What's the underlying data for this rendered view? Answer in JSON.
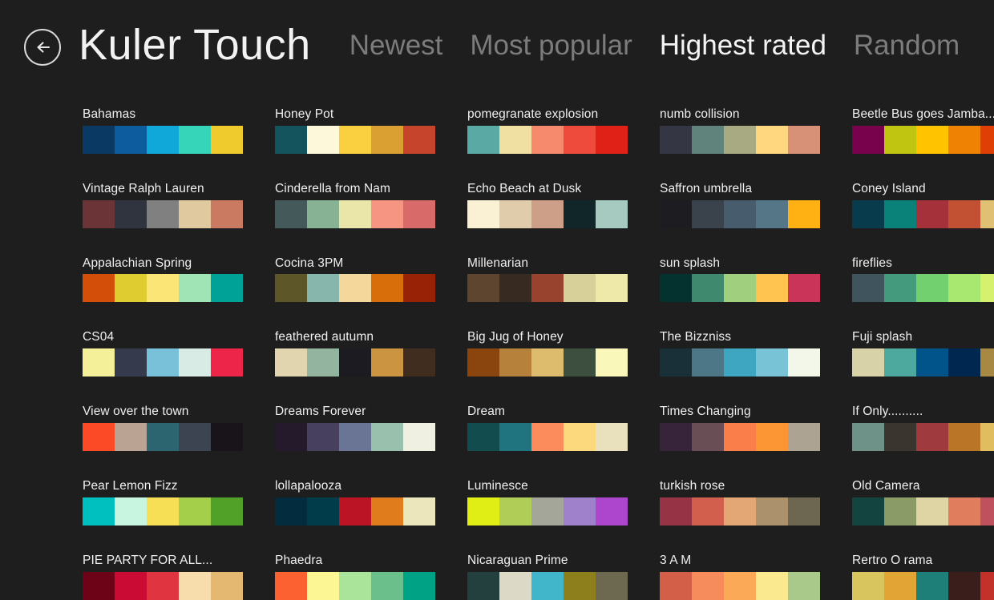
{
  "window": {
    "background": "#1e1e1e",
    "title": "Kuler Touch"
  },
  "header": {
    "back_icon": "back-arrow-circle-icon",
    "title": "Kuler Touch",
    "tabs": [
      {
        "label": "Newest",
        "active": false
      },
      {
        "label": "Most popular",
        "active": false
      },
      {
        "label": "Highest rated",
        "active": true
      },
      {
        "label": "Random",
        "active": false
      }
    ]
  },
  "columns": [
    {
      "palettes": [
        {
          "name": "Bahamas",
          "colors": [
            "#0a3a63",
            "#0c5c9e",
            "#0fa8d8",
            "#36d5ba",
            "#efcb2e"
          ]
        },
        {
          "name": "Vintage Ralph Lauren",
          "colors": [
            "#6b3436",
            "#30343f",
            "#808080",
            "#e0c89f",
            "#cb7a62"
          ]
        },
        {
          "name": "Appalachian Spring",
          "colors": [
            "#d34f09",
            "#dfcc31",
            "#fbe576",
            "#a0e3b5",
            "#00a298"
          ]
        },
        {
          "name": "CS04",
          "colors": [
            "#f4f09a",
            "#353a4c",
            "#79c1d9",
            "#d8ebe4",
            "#ec2549"
          ]
        },
        {
          "name": "View over the town",
          "colors": [
            "#fb4a25",
            "#bba393",
            "#2c6570",
            "#3b4450",
            "#191419"
          ]
        },
        {
          "name": "Pear Lemon Fizz",
          "colors": [
            "#00bfbf",
            "#c8f5e0",
            "#f6df55",
            "#a4cf4b",
            "#51a027"
          ]
        },
        {
          "name": "PIE PARTY  FOR ALL...",
          "colors": [
            "#6c0317",
            "#ca0b33",
            "#e03540",
            "#f6ddab",
            "#e5b872"
          ]
        }
      ]
    },
    {
      "palettes": [
        {
          "name": "Honey Pot",
          "colors": [
            "#14545c",
            "#fdf8d9",
            "#fad041",
            "#dba032",
            "#c7442c"
          ]
        },
        {
          "name": "Cinderella from Nam",
          "colors": [
            "#44595a",
            "#87b394",
            "#eae5a8",
            "#f79583",
            "#d96a6a"
          ]
        },
        {
          "name": "Cocina 3PM",
          "colors": [
            "#5d5628",
            "#87b6ac",
            "#f4d79a",
            "#d86e09",
            "#972206"
          ]
        },
        {
          "name": "feathered autumn",
          "colors": [
            "#e0d5af",
            "#93b59f",
            "#1b1b21",
            "#cb9440",
            "#412c20"
          ]
        },
        {
          "name": "Dreams Forever",
          "colors": [
            "#241a2c",
            "#47405f",
            "#6a7494",
            "#99c0ad",
            "#efefe2"
          ]
        },
        {
          "name": "lollapalooza",
          "colors": [
            "#032d3f",
            "#013c4a",
            "#bb1424",
            "#e07c1c",
            "#ece6bc"
          ]
        },
        {
          "name": "Phaedra",
          "colors": [
            "#fc6131",
            "#fcf694",
            "#aae39a",
            "#6abf8b",
            "#00a285"
          ]
        }
      ]
    },
    {
      "palettes": [
        {
          "name": "pomegranate explosion",
          "colors": [
            "#5aa9a4",
            "#f0e0a2",
            "#f58a6c",
            "#ef4b3c",
            "#e02118"
          ]
        },
        {
          "name": "Echo Beach at Dusk",
          "colors": [
            "#faf0d3",
            "#e0cbab",
            "#cd9f89",
            "#102628",
            "#a6c9c0"
          ]
        },
        {
          "name": "Millenarian",
          "colors": [
            "#5d4530",
            "#362a21",
            "#98432d",
            "#d7d099",
            "#eee9a9"
          ]
        },
        {
          "name": "Big Jug of Honey",
          "colors": [
            "#8a440e",
            "#b6813a",
            "#ddbc6e",
            "#3d5040",
            "#f9f7b9"
          ]
        },
        {
          "name": "Dream",
          "colors": [
            "#134c4f",
            "#1f7480",
            "#fc8c5b",
            "#fcd97c",
            "#e9e1bd"
          ]
        },
        {
          "name": "Luminesce",
          "colors": [
            "#e1ee16",
            "#b0cd58",
            "#a4a699",
            "#9e80cb",
            "#ae45cd"
          ]
        },
        {
          "name": "Nicaraguan Prime",
          "colors": [
            "#23403e",
            "#dcdac6",
            "#41b6ca",
            "#8d7f1b",
            "#6d6850"
          ]
        }
      ]
    },
    {
      "palettes": [
        {
          "name": "numb collision",
          "colors": [
            "#343643",
            "#60837b",
            "#a8ab81",
            "#ffd77f",
            "#d79177"
          ]
        },
        {
          "name": "Saffron umbrella",
          "colors": [
            "#1d1d21",
            "#3a424b",
            "#475d6d",
            "#557686",
            "#ffb013"
          ]
        },
        {
          "name": "sun splash",
          "colors": [
            "#03322f",
            "#3f8a6e",
            "#a0cf7d",
            "#ffc34f",
            "#cb3459"
          ]
        },
        {
          "name": "The Bizzniss",
          "colors": [
            "#1a3039",
            "#4d7687",
            "#3fa6c1",
            "#78c3d6",
            "#f2f7ea"
          ]
        },
        {
          "name": "Times Changing",
          "colors": [
            "#37233a",
            "#6a4e55",
            "#fa7e49",
            "#fc9634",
            "#ada392"
          ]
        },
        {
          "name": "turkish rose",
          "colors": [
            "#963344",
            "#d25f4e",
            "#e2a774",
            "#ab926c",
            "#6d6752"
          ]
        },
        {
          "name": "3 A M",
          "colors": [
            "#d35f48",
            "#f68b5b",
            "#fba957",
            "#fbe98f",
            "#a9c98b"
          ]
        }
      ]
    },
    {
      "palettes": [
        {
          "name": "Beetle Bus goes Jamba...",
          "colors": [
            "#78034c",
            "#c0c511",
            "#ffc300",
            "#f08203",
            "#df3e04"
          ]
        },
        {
          "name": "Coney Island",
          "colors": [
            "#083c4c",
            "#0a8279",
            "#a5323b",
            "#c15132",
            "#e0c173"
          ]
        },
        {
          "name": "fireflies",
          "colors": [
            "#40545d",
            "#449a7d",
            "#72d16e",
            "#a8e871",
            "#d5f16e"
          ]
        },
        {
          "name": "Fuji splash",
          "colors": [
            "#d8d2a8",
            "#4da89d",
            "#00548a",
            "#00274f",
            "#a88944"
          ]
        },
        {
          "name": "If Only..........",
          "colors": [
            "#6e9287",
            "#3b3530",
            "#9f3b3f",
            "#ba7527",
            "#e0bd5f"
          ]
        },
        {
          "name": "Old Camera",
          "colors": [
            "#14443f",
            "#8a9b68",
            "#dfd4a4",
            "#e07d5c",
            "#bf515e"
          ]
        },
        {
          "name": "Rertro O rama",
          "colors": [
            "#d8c55e",
            "#e2a434",
            "#1d7f77",
            "#3a1e1c",
            "#c2322a"
          ]
        }
      ]
    }
  ]
}
